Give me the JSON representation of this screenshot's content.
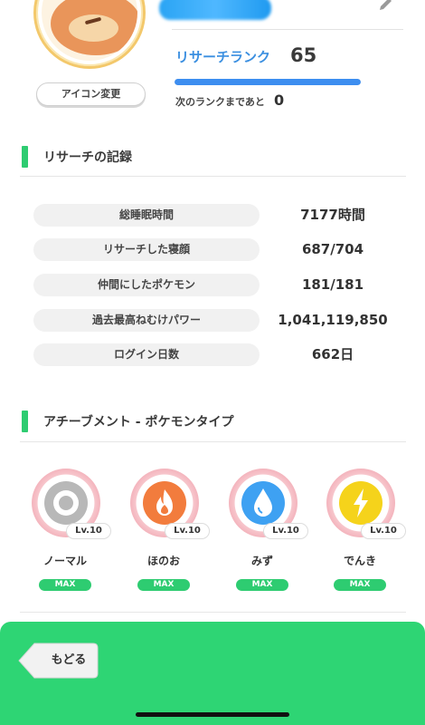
{
  "profile": {
    "icon_change_label": "アイコン変更",
    "rank_label": "リサーチランク",
    "rank_value": "65",
    "rank_progress": 1.0,
    "next_rank_label": "次のランクまであと",
    "next_rank_value": "0"
  },
  "research_record": {
    "title": "リサーチの記録",
    "stats": [
      {
        "label": "総睡眠時間",
        "value": "7177時間"
      },
      {
        "label": "リサーチした寝顔",
        "value": "687/704"
      },
      {
        "label": "仲間にしたポケモン",
        "value": "181/181"
      },
      {
        "label": "過去最高ねむけパワー",
        "value": "1,041,119,850"
      },
      {
        "label": "ログイン日数",
        "value": "662日"
      }
    ]
  },
  "achievement": {
    "title": "アチーブメント - ポケモンタイプ",
    "badges": [
      {
        "name": "ノーマル",
        "level": "Lv.10",
        "status": "MAX",
        "icon": "normal-type-icon",
        "color": "#b8b8b8"
      },
      {
        "name": "ほのお",
        "level": "Lv.10",
        "status": "MAX",
        "icon": "fire-type-icon",
        "color": "#f27c3d"
      },
      {
        "name": "みず",
        "level": "Lv.10",
        "status": "MAX",
        "icon": "water-type-icon",
        "color": "#3ea1f2"
      },
      {
        "name": "でんき",
        "level": "Lv.10",
        "status": "MAX",
        "icon": "electric-type-icon",
        "color": "#f5d31b"
      }
    ]
  },
  "footer": {
    "back_label": "もどる"
  },
  "colors": {
    "accent_green": "#2ed574",
    "rank_blue": "#3b8fe0"
  }
}
